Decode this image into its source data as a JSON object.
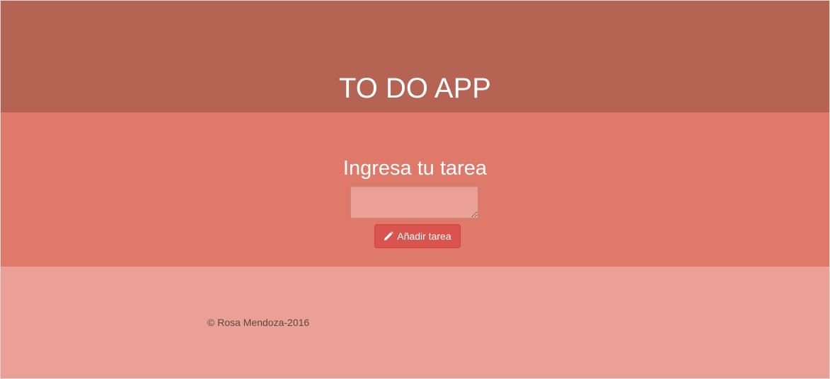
{
  "header": {
    "title": "TO DO APP"
  },
  "main": {
    "prompt": "Ingresa tu tarea",
    "task_input": {
      "value": "",
      "placeholder": ""
    },
    "add_button": {
      "label": "Añadir tarea",
      "icon": "pencil-icon"
    }
  },
  "footer": {
    "copyright": "© Rosa Mendoza-2016"
  },
  "colors": {
    "header_bg": "#b56453",
    "main_bg": "#df7a6b",
    "footer_bg": "#eba095",
    "button_bg": "#d9534f"
  }
}
